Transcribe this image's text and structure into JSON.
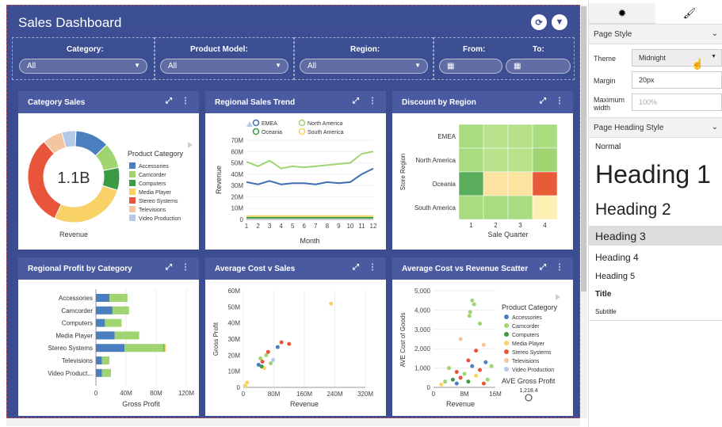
{
  "dashboard": {
    "title": "Sales Dashboard",
    "filters": {
      "category": {
        "label": "Category:",
        "value": "All"
      },
      "product_model": {
        "label": "Product Model:",
        "value": "All"
      },
      "region": {
        "label": "Region:",
        "value": "All"
      },
      "from": {
        "label": "From:"
      },
      "to": {
        "label": "To:"
      }
    }
  },
  "panels": {
    "category_sales": {
      "title": "Category Sales",
      "center_value": "1.1B",
      "xlabel": "Revenue",
      "legend_title": "Product Category",
      "slices": [
        {
          "name": "Accessories",
          "value": 12,
          "color": "#4a7ebf"
        },
        {
          "name": "Camcorder",
          "value": 9,
          "color": "#9fd471"
        },
        {
          "name": "Computers",
          "value": 8,
          "color": "#3a9b44"
        },
        {
          "name": "Media Player",
          "value": 27,
          "color": "#f8d266"
        },
        {
          "name": "Stereo Systems",
          "value": 32,
          "color": "#e8553a"
        },
        {
          "name": "Televisions",
          "value": 7,
          "color": "#f3c5a0"
        },
        {
          "name": "Video Production",
          "value": 5,
          "color": "#b5c9e8"
        }
      ]
    },
    "regional_trend": {
      "title": "Regional Sales Trend",
      "xlabel": "Month",
      "ylabel": "Revenue",
      "x": [
        1,
        2,
        3,
        4,
        5,
        6,
        7,
        8,
        9,
        10,
        11,
        12
      ],
      "yticks": [
        "0",
        "10M",
        "20M",
        "30M",
        "40M",
        "50M",
        "60M",
        "70M"
      ],
      "series": [
        {
          "name": "EMEA",
          "color": "#3f6fb0",
          "values": [
            33,
            31,
            34,
            31,
            32,
            32,
            31,
            33,
            32,
            33,
            40,
            45
          ]
        },
        {
          "name": "North America",
          "color": "#9fd471",
          "values": [
            51,
            47,
            52,
            45,
            47,
            46,
            47,
            48,
            49,
            50,
            58,
            60
          ]
        },
        {
          "name": "Oceania",
          "color": "#3a9b44",
          "values": [
            1.5,
            1.5,
            1.5,
            1.5,
            1.5,
            1.5,
            1.5,
            1.5,
            1.5,
            1.5,
            1.5,
            1.5
          ]
        },
        {
          "name": "South America",
          "color": "#f8d266",
          "values": [
            3,
            3,
            3,
            3,
            3,
            3,
            3,
            3,
            3,
            3,
            3,
            3
          ]
        }
      ]
    },
    "discount_region": {
      "title": "Discount by Region",
      "xlabel": "Sale Quarter",
      "ylabel": "Store Region",
      "rows": [
        "EMEA",
        "North America",
        "Oceania",
        "South America"
      ],
      "cols": [
        "1",
        "2",
        "3",
        "4"
      ],
      "colors": [
        [
          "#a8dc80",
          "#b8e28c",
          "#b6e18a",
          "#a8dc80"
        ],
        [
          "#a8dc80",
          "#b8e28c",
          "#b8e28c",
          "#9fd471"
        ],
        [
          "#5aad5a",
          "#fde3a0",
          "#fde3a0",
          "#e85a38"
        ],
        [
          "#a8dc80",
          "#a8dc80",
          "#a8dc80",
          "#fef0b2"
        ]
      ]
    },
    "regional_profit": {
      "title": "Regional Profit by Category",
      "xlabel": "Gross Profit",
      "xticks": [
        "0",
        "40M",
        "80M",
        "120M"
      ],
      "categories": [
        "Accessories",
        "Camcorder",
        "Computers",
        "Media Player",
        "Stereo Systems",
        "Televisions",
        "Video Product..."
      ],
      "series": [
        {
          "name": "EMEA",
          "color": "#4a7ebf",
          "values": [
            18,
            22,
            12,
            25,
            38,
            8,
            8
          ]
        },
        {
          "name": "North America",
          "color": "#9fd471",
          "values": [
            24,
            22,
            22,
            32,
            52,
            10,
            12
          ]
        },
        {
          "name": "Oceania",
          "color": "#3a9b44",
          "values": [
            0,
            0,
            0,
            0,
            1,
            0,
            0
          ]
        },
        {
          "name": "South America",
          "color": "#f8d266",
          "values": [
            0,
            0,
            0,
            1,
            2,
            0,
            0
          ]
        }
      ]
    },
    "avg_cost": {
      "title": "Average Cost v Sales",
      "xlabel": "Revenue",
      "ylabel": "Gross Profit",
      "xticks": [
        "0",
        "80M",
        "160M",
        "240M",
        "320M"
      ],
      "yticks": [
        "0",
        "10M",
        "20M",
        "30M",
        "40M",
        "50M",
        "60M"
      ],
      "points": [
        {
          "x": 5,
          "y": 1,
          "color": "#f8d266"
        },
        {
          "x": 10,
          "y": 3,
          "color": "#f8d266"
        },
        {
          "x": 40,
          "y": 14,
          "color": "#4a7ebf"
        },
        {
          "x": 45,
          "y": 18,
          "color": "#9fd471"
        },
        {
          "x": 50,
          "y": 16,
          "color": "#e8553a"
        },
        {
          "x": 55,
          "y": 12,
          "color": "#f8d266"
        },
        {
          "x": 60,
          "y": 20,
          "color": "#9fd471"
        },
        {
          "x": 65,
          "y": 22,
          "color": "#e8553a"
        },
        {
          "x": 72,
          "y": 15,
          "color": "#9fd471"
        },
        {
          "x": 78,
          "y": 17,
          "color": "#b5c9e8"
        },
        {
          "x": 90,
          "y": 25,
          "color": "#4a7ebf"
        },
        {
          "x": 100,
          "y": 28,
          "color": "#e8553a"
        },
        {
          "x": 120,
          "y": 27,
          "color": "#e8553a"
        },
        {
          "x": 48,
          "y": 13,
          "color": "#3a9b44"
        },
        {
          "x": 230,
          "y": 52,
          "color": "#f8d266"
        }
      ]
    },
    "avg_cost_scatter": {
      "title": "Average Cost vs Revenue Scatter",
      "xlabel": "Revenue",
      "ylabel": "AVE Cost of Goods",
      "xticks": [
        "0",
        "8M",
        "16M"
      ],
      "yticks": [
        "0",
        "1,000",
        "2,000",
        "3,000",
        "4,000",
        "5,000"
      ],
      "legend_title": "Product Category",
      "legend": [
        {
          "name": "Accessories",
          "color": "#4a7ebf"
        },
        {
          "name": "Camcorder",
          "color": "#9fd471"
        },
        {
          "name": "Computers",
          "color": "#3a9b44"
        },
        {
          "name": "Media Player",
          "color": "#f8d266"
        },
        {
          "name": "Stereo Systems",
          "color": "#e8553a"
        },
        {
          "name": "Televisions",
          "color": "#f3c5a0"
        },
        {
          "name": "Video Production",
          "color": "#b5c9e8"
        }
      ],
      "size_title": "AVE Gross Profit",
      "size_value": "1,218.4",
      "points": [
        {
          "x": 10,
          "y": 4500,
          "color": "#9fd471"
        },
        {
          "x": 10.5,
          "y": 4300,
          "color": "#9fd471"
        },
        {
          "x": 9.5,
          "y": 3900,
          "color": "#9fd471"
        },
        {
          "x": 9.3,
          "y": 3700,
          "color": "#9fd471"
        },
        {
          "x": 12,
          "y": 3300,
          "color": "#9fd471"
        },
        {
          "x": 7,
          "y": 2500,
          "color": "#f3c5a0"
        },
        {
          "x": 13,
          "y": 2200,
          "color": "#f3c5a0"
        },
        {
          "x": 11,
          "y": 1900,
          "color": "#e8553a"
        },
        {
          "x": 9,
          "y": 1400,
          "color": "#e8553a"
        },
        {
          "x": 13.5,
          "y": 1300,
          "color": "#4a7ebf"
        },
        {
          "x": 10,
          "y": 1100,
          "color": "#4a7ebf"
        },
        {
          "x": 4,
          "y": 1000,
          "color": "#9fd471"
        },
        {
          "x": 6,
          "y": 800,
          "color": "#e8553a"
        },
        {
          "x": 8,
          "y": 700,
          "color": "#9fd471"
        },
        {
          "x": 12,
          "y": 900,
          "color": "#e8553a"
        },
        {
          "x": 3,
          "y": 300,
          "color": "#9fd471"
        },
        {
          "x": 5,
          "y": 400,
          "color": "#3a9b44"
        },
        {
          "x": 7,
          "y": 500,
          "color": "#e8553a"
        },
        {
          "x": 9,
          "y": 300,
          "color": "#3a9b44"
        },
        {
          "x": 11,
          "y": 600,
          "color": "#f8d266"
        },
        {
          "x": 2,
          "y": 150,
          "color": "#f8d266"
        },
        {
          "x": 14,
          "y": 400,
          "color": "#9fd471"
        },
        {
          "x": 15,
          "y": 1100,
          "color": "#9fd471"
        },
        {
          "x": 6,
          "y": 200,
          "color": "#4a7ebf"
        },
        {
          "x": 13,
          "y": 200,
          "color": "#e8553a"
        }
      ]
    }
  },
  "sidebar": {
    "page_style": {
      "header": "Page Style",
      "theme_label": "Theme",
      "theme_value": "Midnight",
      "margin_label": "Margin",
      "margin_value": "20px",
      "max_width_label": "Maximum width",
      "max_width_placeholder": "100%"
    },
    "heading_style": {
      "header": "Page Heading Style",
      "items": [
        "Normal",
        "Heading 1",
        "Heading 2",
        "Heading 3",
        "Heading 4",
        "Heading 5",
        "Title",
        "Subtitle"
      ]
    }
  }
}
